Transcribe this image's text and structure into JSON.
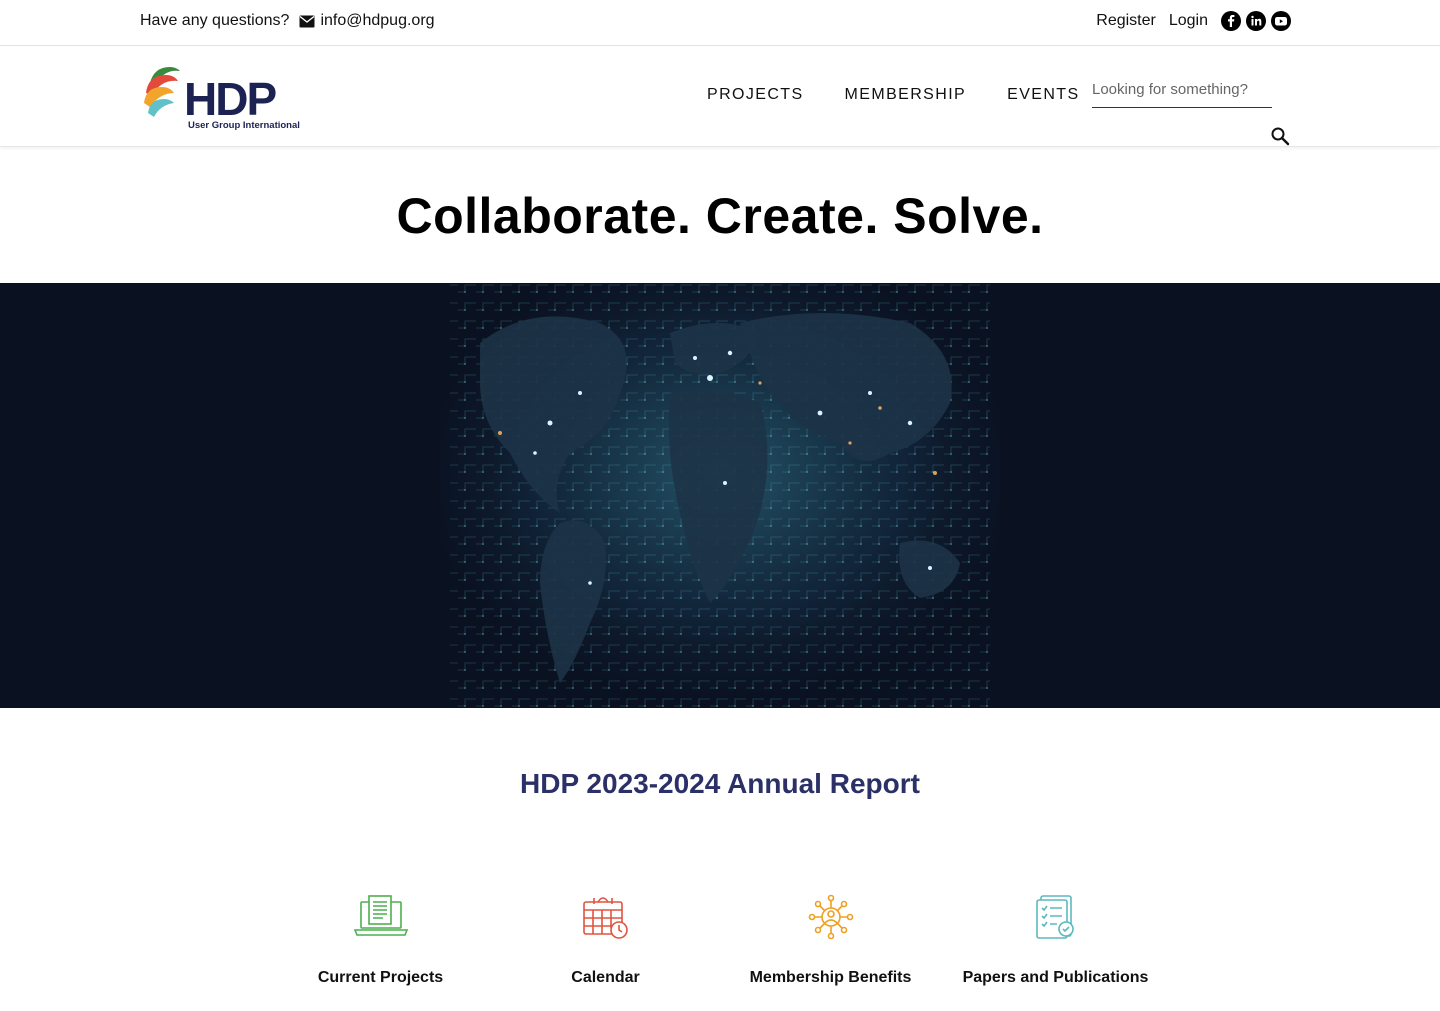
{
  "topbar": {
    "question": "Have any questions?",
    "email": "info@hdpug.org",
    "register": "Register",
    "login": "Login"
  },
  "header": {
    "logo_text": "HDP",
    "logo_subtitle": "User Group International",
    "nav": [
      "PROJECTS",
      "MEMBERSHIP",
      "EVENTS"
    ],
    "search_placeholder": "Looking for something?"
  },
  "headline": "Collaborate. Create. Solve.",
  "report_title": "HDP 2023-2024 Annual Report",
  "features": [
    {
      "label": "Current Projects",
      "icon": "laptop-document-icon",
      "color": "#4caf50"
    },
    {
      "label": "Calendar",
      "icon": "calendar-clock-icon",
      "color": "#e0533f"
    },
    {
      "label": "Membership Benefits",
      "icon": "network-people-icon",
      "color": "#f0a020"
    },
    {
      "label": "Papers and Publications",
      "icon": "checklist-document-icon",
      "color": "#5bb8c0"
    }
  ],
  "colors": {
    "brand_navy": "#2b3067",
    "hero_bg": "#0a1120"
  }
}
